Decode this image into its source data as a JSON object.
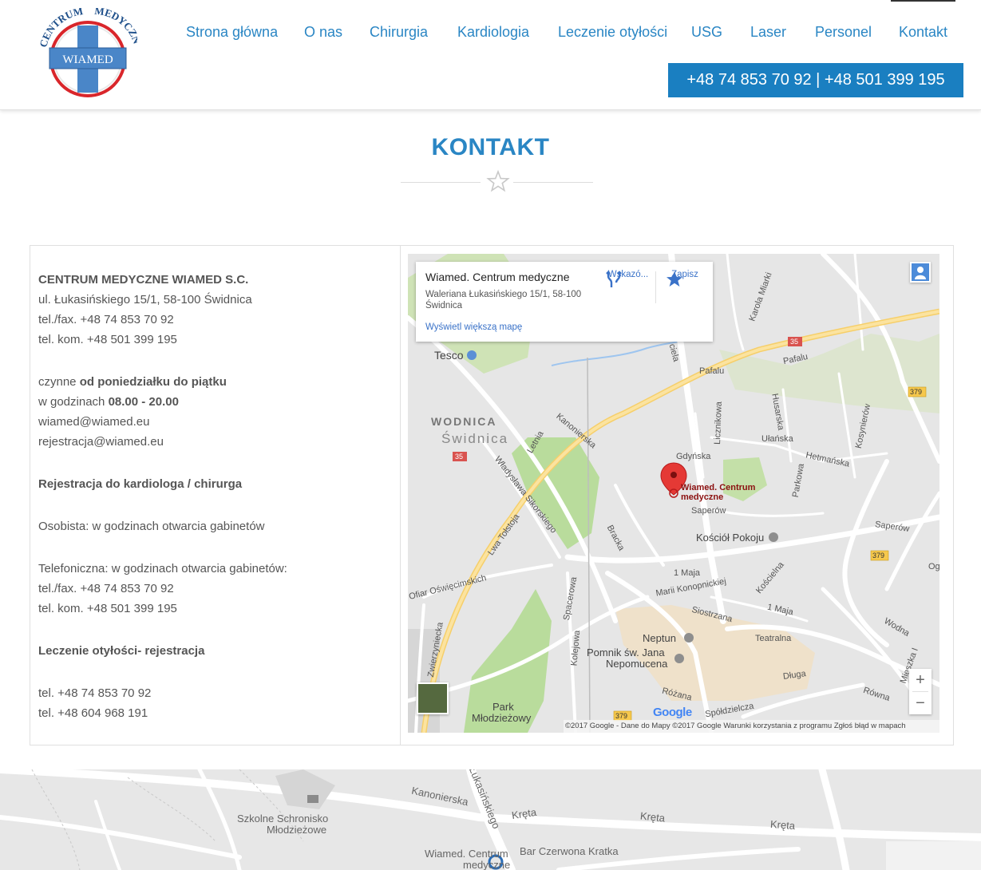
{
  "logo": {
    "arc_text_left": "CENTRUM",
    "arc_text_right": "MEDYCZNE",
    "brand": "WIAMED"
  },
  "nav": {
    "items": [
      {
        "label": "Strona główna"
      },
      {
        "label": "O nas"
      },
      {
        "label": "Chirurgia"
      },
      {
        "label": "Kardiologia"
      },
      {
        "label": "Leczenie otyłości"
      },
      {
        "label": "USG"
      },
      {
        "label": "Laser"
      },
      {
        "label": "Personel"
      },
      {
        "label": "Kontakt"
      }
    ],
    "active": "Kontakt",
    "phone": "+48 74 853 70 92  |  +48 501 399 195"
  },
  "page": {
    "title": "KONTAKT"
  },
  "info": {
    "company": "CENTRUM MEDYCZNE WIAMED S.C.",
    "address": "ul. Łukasińskiego 15/1, 58-100 Świdnica",
    "tel_fax": "tel./fax. +48 74 853 70 92",
    "tel_kom": "tel. kom. +48 501 399 195",
    "open_prefix": "czynne ",
    "open_days": "od poniedziałku do piątku",
    "hours_prefix": "w godzinach ",
    "hours": "08.00 - 20.00",
    "email1": "wiamed@wiamed.eu",
    "email2": "rejestracja@wiamed.eu",
    "reg_heading": "Rejestracja do kardiologa / chirurga",
    "personal": "Osobista: w godzinach otwarcia gabinetów",
    "phone_reg": "Telefoniczna: w godzinach otwarcia gabinetów:",
    "tel_fax2": "tel./fax. +48 74 853 70 92",
    "tel_kom2": "tel. kom. +48 501 399 195",
    "obesity_heading": "Leczenie otyłości- rejestracja",
    "obesity_tel1": "tel. +48 74 853 70 92",
    "obesity_tel2": "tel. +48 604 968 191"
  },
  "map": {
    "card_title": "Wiamed. Centrum medyczne",
    "card_address": "Waleriana Łukasińskiego 15/1, 58-100 Świdnica",
    "card_link": "Wyświetl większą mapę",
    "directions_label": "Wskazó...",
    "save_label": "Zapisz",
    "marker_label_1": "Wiamed. Centrum",
    "marker_label_2": "medyczne",
    "zoom_in": "+",
    "zoom_out": "−",
    "footer": "©2017 Google - Dane do Mapy ©2017 Google   Warunki korzystania z programu   Zgłoś błąd w mapach",
    "google": "Google",
    "labels": {
      "tesco": "Tesco",
      "wodnica": "WODNICA",
      "swidnica": "Świdnica",
      "kanonierska": "Kanonierska",
      "gdynska": "Gdyńska",
      "ulanska": "Ułańska",
      "husarska": "Husarska",
      "licznikowa": "Licznikowa",
      "hetmanska": "Hetmańska",
      "kosynierow": "Kosynierów",
      "parkowa": "Parkowa",
      "pafalu1": "Pafalu",
      "pafalu2": "Pafalu",
      "karola_miarki": "Karola Miarki",
      "saperow1": "Saperów",
      "saperow2": "Saperów",
      "kosciol": "Kościół Pokoju",
      "sikorskiego": "Władysława Sikorskiego",
      "tolstoja": "Lwa Tołstoja",
      "letnia": "Letnia",
      "bracka": "Bracka",
      "maja1": "1 Maja",
      "maja2": "1 Maja",
      "konopnickiej": "Marii Konopnickiej",
      "koscielna": "Kościelna",
      "siostrzana": "Siostrzana",
      "teatralna": "Teatralna",
      "wodna": "Wodna",
      "mieszka": "Mieszka I",
      "oswiecimskich": "Ofiar Oświęcimskich",
      "spacerowa": "Spacerowa",
      "zwierzyniecka": "Zwierzyniecka",
      "kolejowa": "Kolejowa",
      "neptun": "Neptun",
      "pomnik1": "Pomnik św. Jana",
      "pomnik2": "Nepomucena",
      "dluga": "Długa",
      "rowna": "Równa",
      "rozana": "Różana",
      "spoldzielcza": "Spółdzielcza",
      "park1": "Park",
      "park2": "Młodzieżowy",
      "ciela": "ciela",
      "og": "Og",
      "r35a": "35",
      "r35b": "35",
      "r379a": "379",
      "r379b": "379",
      "r379c": "379"
    }
  },
  "bigmap": {
    "labels": {
      "kanonierska": "Kanonierska",
      "lukasinskiego": "Łukasińskiego",
      "kreta1": "Kręta",
      "kreta2": "Kręta",
      "kreta3": "Kręta",
      "schronisko1": "Szkolne Schronisko",
      "schronisko2": "Młodzieżowe",
      "wiamed1": "Wiamed. Centrum",
      "wiamed2": "medyczne",
      "bar": "Bar Czerwona Kratka"
    }
  },
  "colors": {
    "brand_blue": "#2a86c4",
    "phone_bg": "#1a7fc1",
    "logo_red": "#d9262b",
    "logo_blue": "#3b7fc4"
  }
}
